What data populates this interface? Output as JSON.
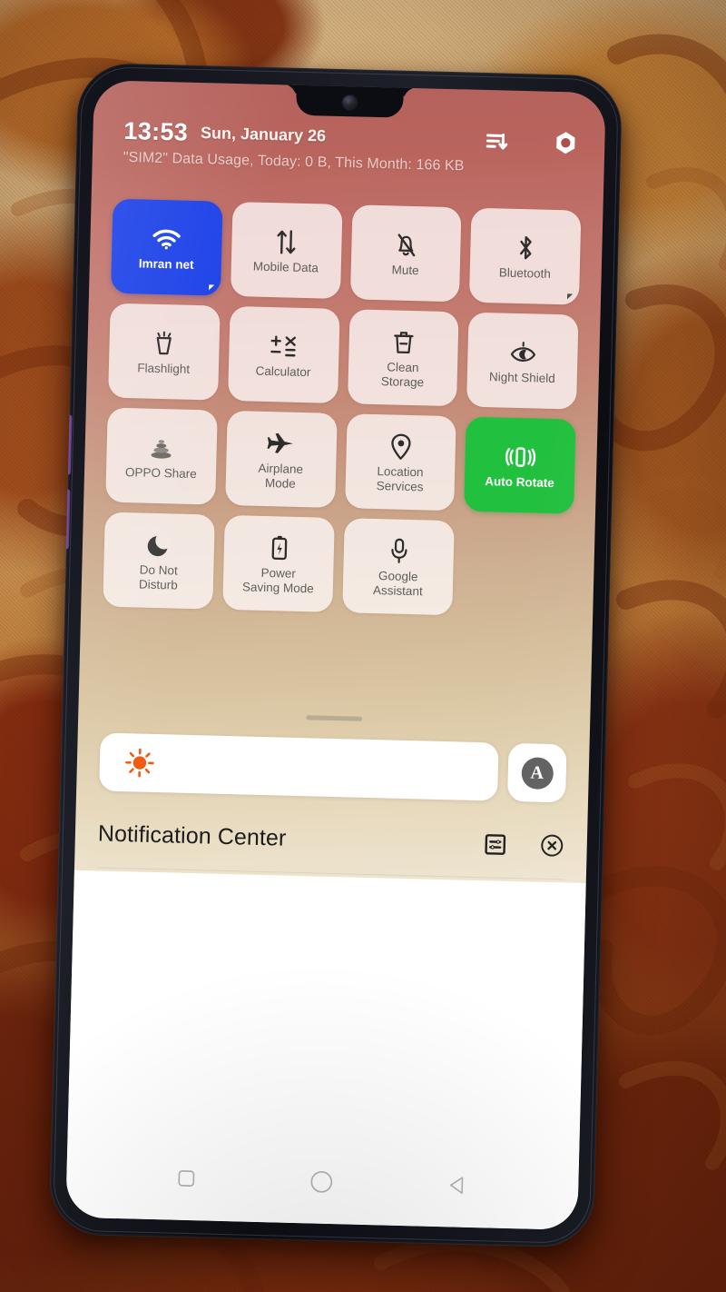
{
  "device": {
    "type": "oppo-smartphone",
    "orientation": "portrait",
    "panel": "quick-settings-notification-shade"
  },
  "status_bar": {
    "time": "13:53",
    "date": "Sun, January 26",
    "data_usage": "\"SIM2\" Data Usage, Today: 0 B, This Month: 166 KB",
    "sort_icon": "sort-descending-icon",
    "settings_icon": "gear-hex-icon"
  },
  "quick_settings": {
    "rows": [
      [
        {
          "label": "Imran net",
          "icon": "wifi-icon",
          "state": "on",
          "color": "#1e43e8",
          "expandable": true
        },
        {
          "label": "Mobile Data",
          "icon": "data-transfer-icon",
          "state": "off",
          "expandable": false
        },
        {
          "label": "Mute",
          "icon": "bell-muted-icon",
          "state": "off",
          "expandable": false
        },
        {
          "label": "Bluetooth",
          "icon": "bluetooth-icon",
          "state": "off",
          "expandable": true
        }
      ],
      [
        {
          "label": "Flashlight",
          "icon": "flashlight-icon",
          "state": "off",
          "expandable": false
        },
        {
          "label": "Calculator",
          "icon": "calculator-icon",
          "state": "off",
          "expandable": false
        },
        {
          "label": "Clean\nStorage",
          "icon": "trash-icon",
          "state": "off",
          "expandable": false
        },
        {
          "label": "Night Shield",
          "icon": "eye-moon-icon",
          "state": "off",
          "expandable": false
        }
      ],
      [
        {
          "label": "OPPO Share",
          "icon": "oppo-share-icon",
          "state": "off",
          "expandable": false
        },
        {
          "label": "Airplane\nMode",
          "icon": "airplane-icon",
          "state": "off",
          "expandable": false
        },
        {
          "label": "Location\nServices",
          "icon": "location-pin-icon",
          "state": "off",
          "expandable": false
        },
        {
          "label": "Auto Rotate",
          "icon": "auto-rotate-icon",
          "state": "on",
          "color": "#22c03f",
          "expandable": false
        }
      ],
      [
        {
          "label": "Do Not\nDisturb",
          "icon": "moon-icon",
          "state": "off",
          "expandable": false
        },
        {
          "label": "Power\nSaving Mode",
          "icon": "battery-bolt-icon",
          "state": "off",
          "expandable": false
        },
        {
          "label": "Google\nAssistant",
          "icon": "microphone-icon",
          "state": "off",
          "expandable": false
        }
      ]
    ]
  },
  "brightness": {
    "icon": "sun-icon",
    "icon_color": "#f05a11",
    "level_percent": 15,
    "auto_label": "A",
    "auto_enabled": true
  },
  "notification_center": {
    "title": "Notification Center",
    "manage_icon": "notification-settings-icon",
    "clear_all_icon": "clear-all-circle-x-icon",
    "notifications": []
  },
  "navigation_bar": {
    "buttons": [
      {
        "name": "recents",
        "icon": "square-icon"
      },
      {
        "name": "home",
        "icon": "circle-icon"
      },
      {
        "name": "back",
        "icon": "triangle-left-icon"
      }
    ]
  }
}
